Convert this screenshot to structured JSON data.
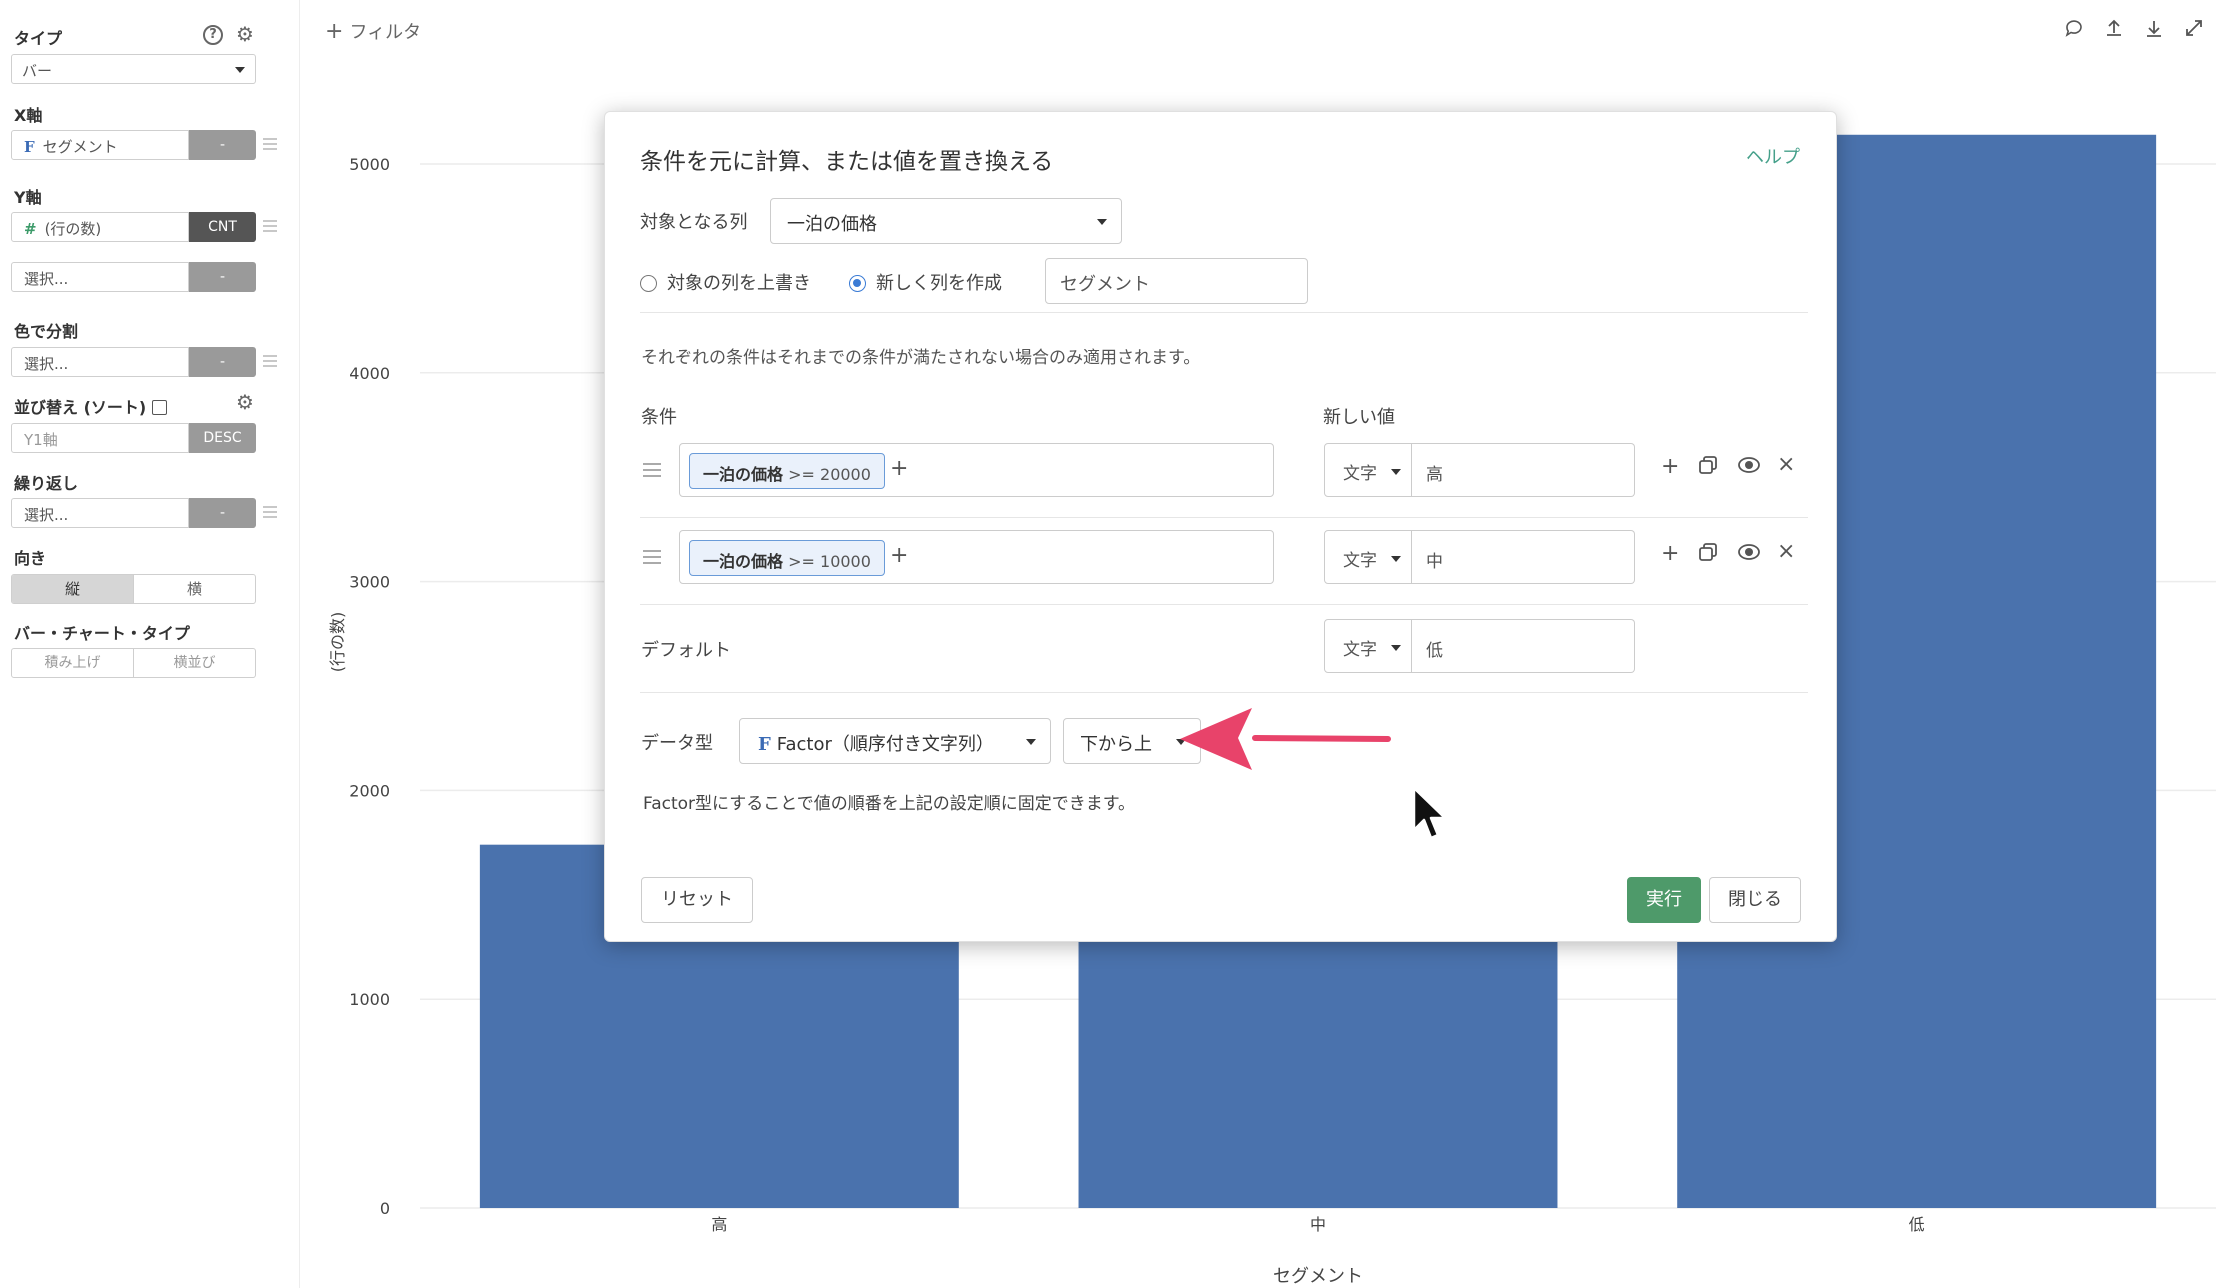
{
  "sidebar": {
    "type_label": "タイプ",
    "type_value": "バー",
    "xaxis_label": "X軸",
    "xaxis_field": "セグメント",
    "xaxis_agg": "-",
    "yaxis_label": "Y軸",
    "yaxis_field": "(行の数)",
    "yaxis_agg": "CNT",
    "yaxis2_placeholder": "選択...",
    "yaxis2_agg": "-",
    "color_label": "色で分割",
    "color_placeholder": "選択...",
    "color_agg": "-",
    "sort_label": "並び替え (ソート)",
    "sort_field": "Y1軸",
    "sort_order": "DESC",
    "repeat_label": "繰り返し",
    "repeat_placeholder": "選択...",
    "repeat_agg": "-",
    "orientation_label": "向き",
    "orientation_options": [
      "縦",
      "横"
    ],
    "bar_type_label": "バー・チャート・タイプ",
    "bar_type_options": [
      "積み上げ",
      "横並び"
    ]
  },
  "toolbar": {
    "filter_label": "フィルタ",
    "icons": [
      "comment-icon",
      "upload-icon",
      "download-icon",
      "expand-icon"
    ]
  },
  "chart_data": {
    "type": "bar",
    "categories": [
      "高",
      "中",
      "低"
    ],
    "values": [
      1740,
      4400,
      5140
    ],
    "xlabel": "セグメント",
    "ylabel": "(行の数)",
    "ylim": [
      0,
      5000
    ],
    "yticks": [
      0,
      1000,
      2000,
      3000,
      4000,
      5000
    ],
    "color": "#4a72ad",
    "grid": true
  },
  "modal": {
    "title": "条件を元に計算、または値を置き換える",
    "help_label": "ヘルプ",
    "target_column_label": "対象となる列",
    "target_column_value": "一泊の価格",
    "overwrite_label": "対象の列を上書き",
    "new_column_label": "新しく列を作成",
    "new_column_name": "セグメント",
    "description": "それぞれの条件はそれまでの条件が満たされない場合のみ適用されます。",
    "condition_header": "条件",
    "new_value_header": "新しい値",
    "rows": [
      {
        "column": "一泊の価格",
        "operator": ">=",
        "value": "20000",
        "type": "文字",
        "new_value": "高"
      },
      {
        "column": "一泊の価格",
        "operator": ">=",
        "value": "10000",
        "type": "文字",
        "new_value": "中"
      }
    ],
    "default_label": "デフォルト",
    "default_type": "文字",
    "default_value": "低",
    "data_type_label": "データ型",
    "data_type_value": "Factor（順序付き文字列）",
    "order_value": "下から上",
    "factor_note": "Factor型にすることで値の順番を上記の設定順に固定できます。",
    "reset_label": "リセット",
    "run_label": "実行",
    "close_label": "閉じる"
  },
  "colors": {
    "bar": "#4a72ad",
    "accent_green": "#4e9a6a",
    "help_link": "#45a08a",
    "arrow": "#e8436a",
    "chip_border": "#6a9bd8"
  }
}
